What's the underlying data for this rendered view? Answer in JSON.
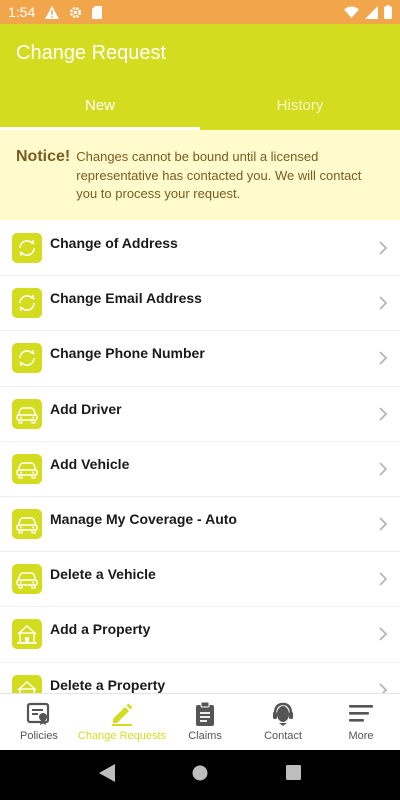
{
  "status_bar": {
    "time": "1:54",
    "icons": [
      "warning-icon",
      "settings-icon",
      "sd-card-icon",
      "wifi-icon",
      "signal-icon",
      "battery-icon"
    ]
  },
  "header": {
    "title": "Change Request",
    "tabs": [
      {
        "label": "New",
        "active": true
      },
      {
        "label": "History",
        "active": false
      }
    ]
  },
  "notice": {
    "title": "Notice!",
    "text": "Changes cannot be bound until a licensed representative has contacted you. We will contact you to process your request."
  },
  "list": {
    "items": [
      {
        "label": "Change of Address",
        "icon": "refresh-icon"
      },
      {
        "label": "Change Email Address",
        "icon": "refresh-icon"
      },
      {
        "label": "Change Phone Number",
        "icon": "refresh-icon"
      },
      {
        "label": "Add Driver",
        "icon": "car-icon"
      },
      {
        "label": "Add Vehicle",
        "icon": "car-icon"
      },
      {
        "label": "Manage My Coverage - Auto",
        "icon": "car-icon"
      },
      {
        "label": "Delete a Vehicle",
        "icon": "car-icon"
      },
      {
        "label": "Add a Property",
        "icon": "house-icon"
      },
      {
        "label": "Delete a Property",
        "icon": "house-icon"
      }
    ]
  },
  "bottom_nav": {
    "items": [
      {
        "label": "Policies",
        "icon": "policy-document-icon",
        "active": false
      },
      {
        "label": "Change Requests",
        "icon": "pencil-icon",
        "active": true
      },
      {
        "label": "Claims",
        "icon": "clipboard-icon",
        "active": false
      },
      {
        "label": "Contact",
        "icon": "headset-icon",
        "active": false
      },
      {
        "label": "More",
        "icon": "menu-icon",
        "active": false
      }
    ]
  },
  "colors": {
    "status_bar": "#f2a64c",
    "brand": "#d4dc1f",
    "notice_bg": "#fffbcc",
    "notice_text": "#7a5b22"
  }
}
